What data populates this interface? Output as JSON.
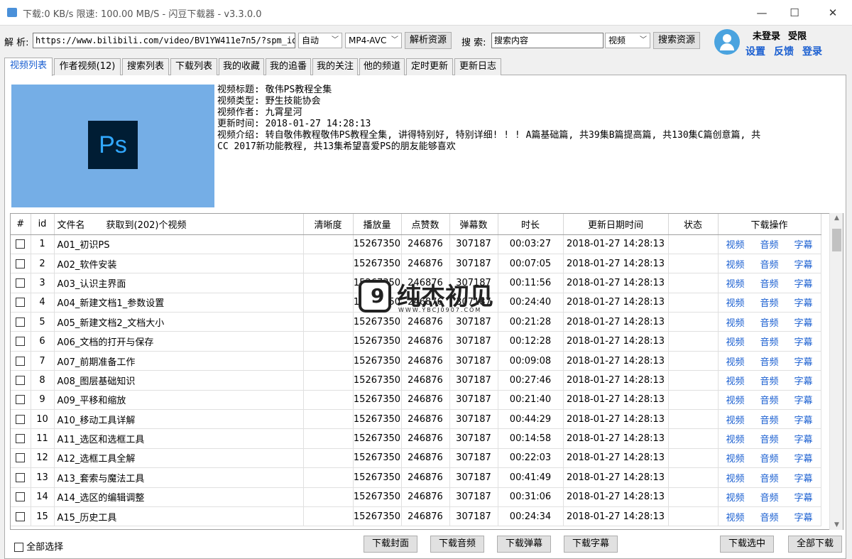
{
  "window": {
    "title": "下载:0 KB/s  限速: 100.00 MB/S  - 闪豆下载器 - v3.3.0.0",
    "minimize_glyph": "—",
    "maximize_glyph": "☐",
    "close_glyph": "✕"
  },
  "toolbar": {
    "parse_label": "解 析:",
    "url_value": "https://www.bilibili.com/video/BV1YW411e7n5/?spm_id_f",
    "quality_value": "自动",
    "format_value": "MP4-AVC",
    "parse_button": "解析资源",
    "search_label": "搜 索:",
    "search_value": "搜索内容",
    "search_type_value": "视频",
    "search_button": "搜索资源"
  },
  "user": {
    "status": "未登录",
    "role": "受限",
    "settings": "设置",
    "feedback": "反馈",
    "login": "登录"
  },
  "tabs": [
    {
      "label": "视频列表"
    },
    {
      "label": "作者视频(12)"
    },
    {
      "label": "搜索列表"
    },
    {
      "label": "下载列表"
    },
    {
      "label": "我的收藏"
    },
    {
      "label": "我的追番"
    },
    {
      "label": "我的关注"
    },
    {
      "label": "他的频道"
    },
    {
      "label": "定时更新"
    },
    {
      "label": "更新日志"
    }
  ],
  "active_tab": "视频列表",
  "video": {
    "thumbnail_text": "Ps",
    "title_line": "视频标题: 敬伟PS教程全集",
    "type_line": "视频类型: 野生技能协会",
    "author_line": "视频作者: 九霄星河",
    "updated_line": "更新时间: 2018-01-27 14:28:13",
    "intro_line1": "视频介绍: 转自敬伟教程敬伟PS教程全集, 讲得特别好, 特别详细! ! ! A篇基础篇, 共39集B篇提高篇, 共130集C篇创意篇, 共",
    "intro_line2": "CC 2017新功能教程, 共13集希望喜爱PS的朋友能够喜欢"
  },
  "table": {
    "headers": {
      "index": "#",
      "id": "id",
      "filename": "文件名",
      "count_info": "获取到(202)个视频",
      "quality": "清晰度",
      "views": "播放量",
      "likes": "点赞数",
      "danmaku": "弹幕数",
      "duration": "时长",
      "updated": "更新日期时间",
      "status": "状态",
      "actions": "下载操作"
    },
    "action_labels": {
      "video": "视频",
      "audio": "音频",
      "subtitle": "字幕"
    },
    "rows": [
      {
        "id": "1",
        "name": "A01_初识PS",
        "views": "15267350",
        "likes": "246876",
        "danmaku": "307187",
        "duration": "00:03:27",
        "date": "2018-01-27 14:28:13"
      },
      {
        "id": "2",
        "name": "A02_软件安装",
        "views": "15267350",
        "likes": "246876",
        "danmaku": "307187",
        "duration": "00:07:05",
        "date": "2018-01-27 14:28:13"
      },
      {
        "id": "3",
        "name": "A03_认识主界面",
        "views": "15267350",
        "likes": "246876",
        "danmaku": "307187",
        "duration": "00:11:56",
        "date": "2018-01-27 14:28:13"
      },
      {
        "id": "4",
        "name": "A04_新建文档1_参数设置",
        "views": "15267350",
        "likes": "246876",
        "danmaku": "307187",
        "duration": "00:24:40",
        "date": "2018-01-27 14:28:13"
      },
      {
        "id": "5",
        "name": "A05_新建文档2_文档大小",
        "views": "15267350",
        "likes": "246876",
        "danmaku": "307187",
        "duration": "00:21:28",
        "date": "2018-01-27 14:28:13"
      },
      {
        "id": "6",
        "name": "A06_文档的打开与保存",
        "views": "15267350",
        "likes": "246876",
        "danmaku": "307187",
        "duration": "00:12:28",
        "date": "2018-01-27 14:28:13"
      },
      {
        "id": "7",
        "name": "A07_前期准备工作",
        "views": "15267350",
        "likes": "246876",
        "danmaku": "307187",
        "duration": "00:09:08",
        "date": "2018-01-27 14:28:13"
      },
      {
        "id": "8",
        "name": "A08_图层基础知识",
        "views": "15267350",
        "likes": "246876",
        "danmaku": "307187",
        "duration": "00:27:46",
        "date": "2018-01-27 14:28:13"
      },
      {
        "id": "9",
        "name": "A09_平移和缩放",
        "views": "15267350",
        "likes": "246876",
        "danmaku": "307187",
        "duration": "00:21:40",
        "date": "2018-01-27 14:28:13"
      },
      {
        "id": "10",
        "name": "A10_移动工具详解",
        "views": "15267350",
        "likes": "246876",
        "danmaku": "307187",
        "duration": "00:44:29",
        "date": "2018-01-27 14:28:13"
      },
      {
        "id": "11",
        "name": "A11_选区和选框工具",
        "views": "15267350",
        "likes": "246876",
        "danmaku": "307187",
        "duration": "00:14:58",
        "date": "2018-01-27 14:28:13"
      },
      {
        "id": "12",
        "name": "A12_选框工具全解",
        "views": "15267350",
        "likes": "246876",
        "danmaku": "307187",
        "duration": "00:22:03",
        "date": "2018-01-27 14:28:13"
      },
      {
        "id": "13",
        "name": "A13_套索与魔法工具",
        "views": "15267350",
        "likes": "246876",
        "danmaku": "307187",
        "duration": "00:41:49",
        "date": "2018-01-27 14:28:13"
      },
      {
        "id": "14",
        "name": "A14_选区的编辑调整",
        "views": "15267350",
        "likes": "246876",
        "danmaku": "307187",
        "duration": "00:31:06",
        "date": "2018-01-27 14:28:13"
      },
      {
        "id": "15",
        "name": "A15_历史工具",
        "views": "15267350",
        "likes": "246876",
        "danmaku": "307187",
        "duration": "00:24:34",
        "date": "2018-01-27 14:28:13"
      }
    ]
  },
  "watermark": {
    "badge": "9",
    "text": "纯杰初见",
    "url": "WWW.YBCJ0907.COM"
  },
  "bottom": {
    "select_all": "全部选择",
    "download_cover": "下载封面",
    "download_audio": "下载音频",
    "download_danmaku": "下载弹幕",
    "download_subtitle": "下载字幕",
    "download_selected": "下载选中",
    "download_all": "全部下载"
  },
  "colors": {
    "accent": "#1a5fd1",
    "thumbnail_bg": "#75aee6",
    "ps_bg": "#001d34",
    "ps_text": "#31a8ff"
  }
}
